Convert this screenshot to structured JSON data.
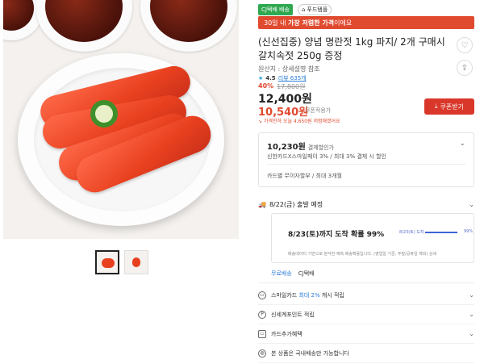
{
  "badges": {
    "promo": "CJ택배 배송",
    "foodie": "푸드탬플"
  },
  "banner": {
    "pre": "30일 내",
    "bold": "가장 저렴한 가격",
    "post": "이에요"
  },
  "product": {
    "title": "(신선집중) 양념 명란젓 1kg 파지/ 2개 구매시 갈치속젓 250g 증정",
    "origin": "원산지 : 상세설명 참조",
    "rating": "4.5",
    "review_count": "리뷰 635개",
    "discount_pct": "40%",
    "original_price": "17,800원",
    "price": "12,400원",
    "coupon_price": "10,540원",
    "coupon_price_label": "쿠폰적용가",
    "lowest_note": "가격인하 오늘 4,650원 저렴해졌어요",
    "coupon_button": "쿠폰받기"
  },
  "card_benefit": {
    "amount": "10,230원",
    "amount_label": "결제할인가",
    "line1": "신한카드X스마일페이 3% / 최대 3% 결제 시 할인",
    "line2": "카드별 무이자할부 / 최대 3개월"
  },
  "shipping": {
    "eta": "8/22(금) 출발 예정",
    "arrive_text": "8/23(토)까지 도착 확률 99%",
    "mini_label": "8/23(토) 도착",
    "probability": 0.99,
    "mini_pct": "99%",
    "note": "배송데이터 기반으로 분석한 예측 배송확률입니다. (영업일 기준, 주말/공휴일 제외) 상세",
    "tag_free": "무료배송",
    "tag_cj": "CJ택배"
  },
  "list": [
    {
      "icon": "card-icon",
      "text_pre": "스마일카드 ",
      "highlight": "최대 2%",
      "text_post": " 캐시 적립"
    },
    {
      "icon": "point-icon",
      "text_pre": "신세계포인트 적립",
      "highlight": "",
      "text_post": ""
    },
    {
      "icon": "card2-icon",
      "text_pre": "카드추가혜택",
      "highlight": "",
      "text_post": ""
    },
    {
      "icon": "globe-icon",
      "text_pre": "본 상품은 국내배송만 가능합니다",
      "highlight": "",
      "text_post": ""
    }
  ],
  "colors": {
    "accent_red": "#e04a2f",
    "coupon_btn": "#d9372a",
    "link_blue": "#2a7bd9",
    "green_badge": "#2fa84f"
  }
}
